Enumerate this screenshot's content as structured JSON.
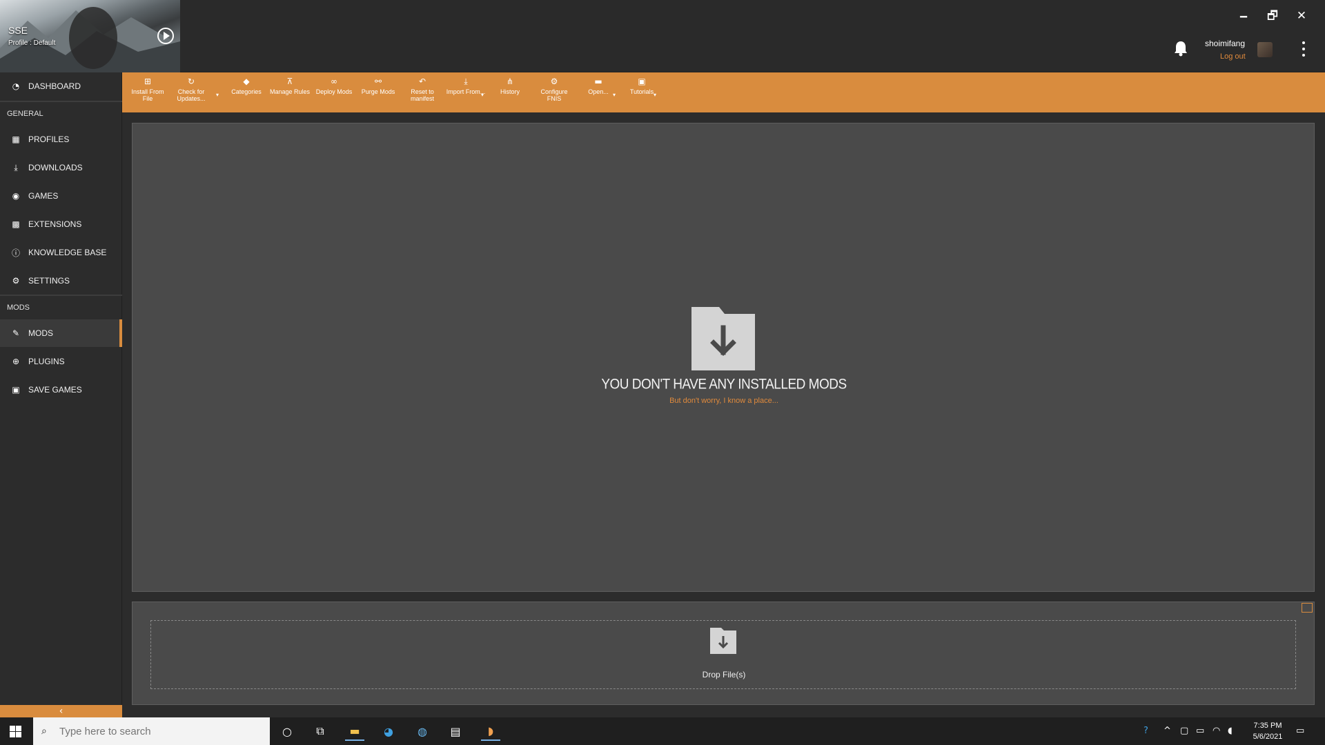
{
  "window": {
    "game_short": "SSE",
    "profile": "Profile : Default",
    "minimize": "🗕",
    "restore": "🗗",
    "close": "✕"
  },
  "user": {
    "name": "shoimifang",
    "logout": "Log out"
  },
  "sidebar": {
    "dashboard": "DASHBOARD",
    "general_header": "GENERAL",
    "general_items": [
      {
        "label": "PROFILES",
        "icon": "profiles-icon"
      },
      {
        "label": "DOWNLOADS",
        "icon": "download-icon"
      },
      {
        "label": "GAMES",
        "icon": "gamepad-icon"
      },
      {
        "label": "EXTENSIONS",
        "icon": "extensions-icon"
      },
      {
        "label": "KNOWLEDGE BASE",
        "icon": "info-icon"
      },
      {
        "label": "SETTINGS",
        "icon": "gear-icon"
      }
    ],
    "mods_header": "MODS",
    "mods_items": [
      {
        "label": "MODS",
        "icon": "wrench-icon",
        "active": true
      },
      {
        "label": "PLUGINS",
        "icon": "plugin-icon"
      },
      {
        "label": "SAVE GAMES",
        "icon": "save-icon"
      }
    ],
    "collapse": "‹"
  },
  "toolbar": {
    "install_from_file": "Install From File",
    "check_updates": "Check for Updates...",
    "categories": "Categories",
    "manage_rules": "Manage Rules",
    "deploy_mods": "Deploy Mods",
    "purge_mods": "Purge Mods",
    "reset_manifest": "Reset to manifest",
    "import_from": "Import From...",
    "history": "History",
    "configure_fnis": "Configure FNIS",
    "open": "Open...",
    "tutorials": "Tutorials"
  },
  "main": {
    "empty_title": "YOU DON'T HAVE ANY INSTALLED MODS",
    "empty_link": "But don't worry, I know a place...",
    "drop_label": "Drop File(s)"
  },
  "taskbar": {
    "search_placeholder": "Type here to search",
    "time": "7:35 PM",
    "date": "5/6/2021"
  },
  "colors": {
    "accent": "#d98c3e",
    "panel": "#4a4a4a",
    "sidebar": "#2c2c2c"
  }
}
